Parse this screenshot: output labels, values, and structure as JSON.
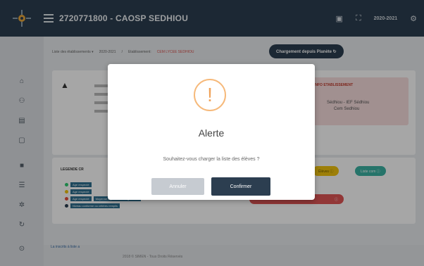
{
  "header": {
    "title": "2720771800 - CAOSP SEDHIOU",
    "year": "2020-2021",
    "icons": [
      "menu-icon",
      "calendar-icon",
      "fullscreen-icon",
      "settings-icon"
    ]
  },
  "sidebar": {
    "icons": [
      "home-icon",
      "users-icon",
      "building-icon",
      "book-icon",
      "folder-icon",
      "list-icon",
      "gear-icon",
      "refresh-icon",
      "info-icon"
    ]
  },
  "breadcrumb": {
    "item1": "Liste des établissements ▾",
    "item2": "2020-2021",
    "sep": "/",
    "item3": "Etablissement:",
    "item3_value": "CEM LYCEE SEDHIOU"
  },
  "reload_button": "Chargement depuis Planète ↻",
  "school_alert": {
    "heading": "INFO ETABLISSEMENT",
    "line1": "Sédhiou - IEF Sédhiou",
    "line2": "Cem Sedhiou"
  },
  "legend": {
    "title": "LEGENDE CR",
    "items": [
      {
        "color": "#2ecc71",
        "tag": "Age respecté"
      },
      {
        "color": "#f1c40f",
        "tag": "Age respecté"
      },
      {
        "color": "#e74c3c",
        "tag": "Age respecté",
        "tag2": "Moyenne supérieure ou égale à 10"
      },
      {
        "color": "#2c3e50",
        "tag": "Niveau conforme ou critères remplis"
      }
    ]
  },
  "pills": {
    "yellow": "Élèves ⓘ",
    "teal": "Liste com ⓘ",
    "red": "ⓘ"
  },
  "footer": {
    "left": "La inscrits à liste a",
    "copyright": "2018 © SIMEN - Tous Droits Réservés"
  },
  "modal": {
    "title": "Alerte",
    "message": "Souhaitez-vous charger la liste des élèves ?",
    "cancel_label": "Annuler",
    "confirm_label": "Confirmer",
    "icon": "warning-icon"
  }
}
